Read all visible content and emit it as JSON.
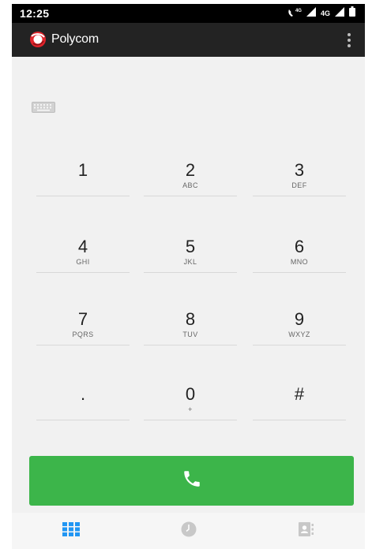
{
  "status_bar": {
    "time": "12:25",
    "network_label": "4G",
    "secondary_network_label": "4G"
  },
  "app_bar": {
    "title": "Polycom",
    "logo_icon": "polycom-logo-icon",
    "menu_icon": "overflow-menu-icon"
  },
  "keyboard_toggle_icon": "keyboard-icon",
  "keypad": [
    {
      "digit": "1",
      "letters": ""
    },
    {
      "digit": "2",
      "letters": "ABC"
    },
    {
      "digit": "3",
      "letters": "DEF"
    },
    {
      "digit": "4",
      "letters": "GHI"
    },
    {
      "digit": "5",
      "letters": "JKL"
    },
    {
      "digit": "6",
      "letters": "MNO"
    },
    {
      "digit": "7",
      "letters": "PQRS"
    },
    {
      "digit": "8",
      "letters": "TUV"
    },
    {
      "digit": "9",
      "letters": "WXYZ"
    },
    {
      "digit": ".",
      "letters": ""
    },
    {
      "digit": "0",
      "letters": "+"
    },
    {
      "digit": "#",
      "letters": ""
    }
  ],
  "call_button": {
    "icon": "phone-icon",
    "color": "#3cb54a"
  },
  "bottom_nav": [
    {
      "icon": "dialpad-icon",
      "active": true,
      "color": "#2196f3"
    },
    {
      "icon": "clock-icon",
      "active": false,
      "color": "#c8c8c8"
    },
    {
      "icon": "contacts-icon",
      "active": false,
      "color": "#c8c8c8"
    }
  ],
  "colors": {
    "app_bar": "#232323",
    "background": "#f1f1f1",
    "accent_blue": "#2196f3"
  }
}
